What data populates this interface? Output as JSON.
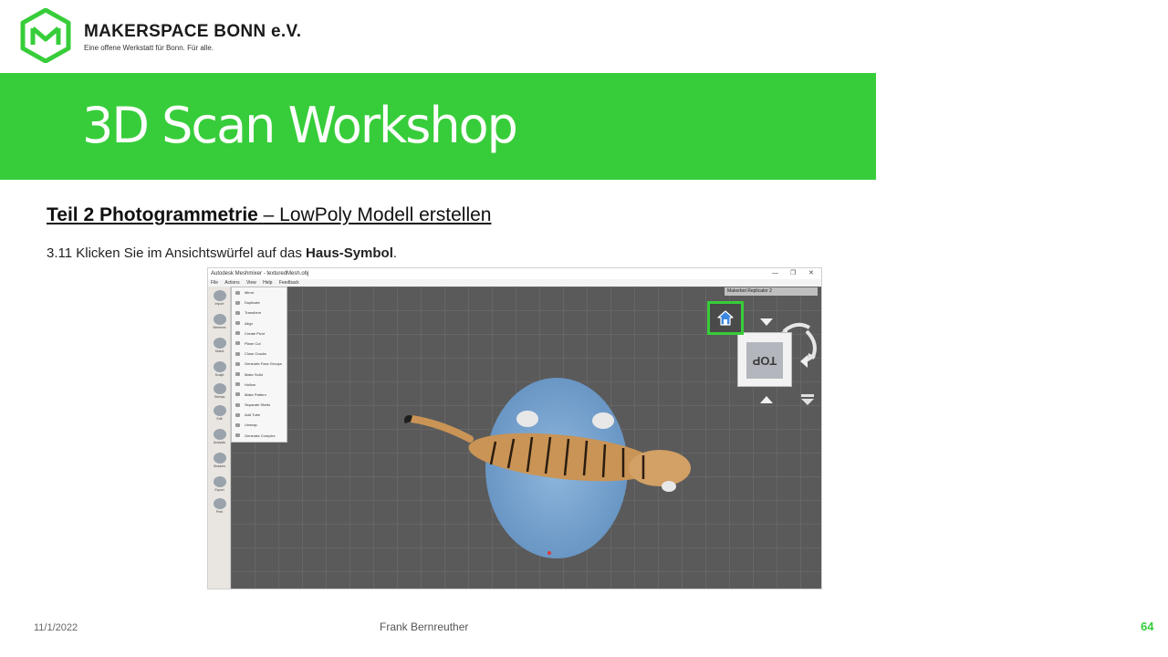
{
  "header": {
    "brand_name": "MAKERSPACE BONN e.V.",
    "brand_tagline": "Eine offene Werkstatt für Bonn. Für alle.",
    "logo_color": "#37cd3a"
  },
  "slide": {
    "title": "3D Scan Workshop",
    "band_color": "#37cd3a",
    "section_bold": "Teil 2  Photogrammetrie ",
    "section_rest": "– LowPoly Modell erstellen",
    "step_prefix": "3.11 Klicken Sie im Ansichtswürfel auf das ",
    "step_bold": "Haus-Symbol",
    "step_suffix": "."
  },
  "screenshot": {
    "window_title": "Autodesk Meshmixer - texturedMesh.obj",
    "window_controls": [
      "—",
      "❐",
      "✕"
    ],
    "menu": [
      "File",
      "Actions",
      "View",
      "Help",
      "Feedback"
    ],
    "machine": "Makerbot Replicator 2",
    "toolbar": [
      "Import",
      "Meshmix",
      "Select",
      "Sculpt",
      "Stamps",
      "Edit",
      "Analysis",
      "Shaders",
      "Export",
      "Print"
    ],
    "edit_menu": [
      "Mirror",
      "Duplicate",
      "Transform",
      "Align",
      "Create Pivot",
      "Plane Cut",
      "Close Cracks",
      "Generate Face Groups",
      "Make Solid",
      "Hollow",
      "Make Pattern",
      "Separate Shells",
      "Add Tube",
      "Unwrap",
      "Generate Complex"
    ],
    "view_cube_face": "TOP",
    "highlight_color": "#37cd3a"
  },
  "footer": {
    "date": "11/1/2022",
    "author": "Frank Bernreuther",
    "page": "64"
  }
}
